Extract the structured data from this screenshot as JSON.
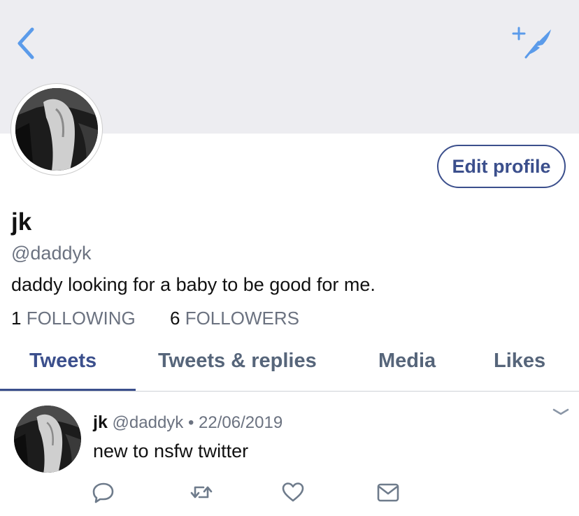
{
  "colors": {
    "banner": "#ededf1",
    "accent": "#3b4f8c",
    "nav_icon": "#5b9bea",
    "muted_text": "#6b7280",
    "action_icon": "#6e7b8b"
  },
  "nav": {
    "back_icon": "chevron-left-icon",
    "compose_icon": "sparkle-feather-icon"
  },
  "profile": {
    "display_name": "jk",
    "handle": "@daddyk",
    "bio": "daddy looking for a baby to be good for me.",
    "edit_label": "Edit profile",
    "following_count": "1",
    "following_label": "FOLLOWING",
    "followers_count": "6",
    "followers_label": "FOLLOWERS"
  },
  "tabs": [
    {
      "label": "Tweets",
      "active": true
    },
    {
      "label": "Tweets & replies",
      "active": false
    },
    {
      "label": "Media",
      "active": false
    },
    {
      "label": "Likes",
      "active": false
    }
  ],
  "tweet": {
    "name": "jk",
    "handle": "@daddyk",
    "separator": "•",
    "date": "22/06/2019",
    "text": "new to nsfw twitter",
    "actions": [
      "reply-icon",
      "retweet-icon",
      "heart-icon",
      "mail-icon"
    ]
  }
}
